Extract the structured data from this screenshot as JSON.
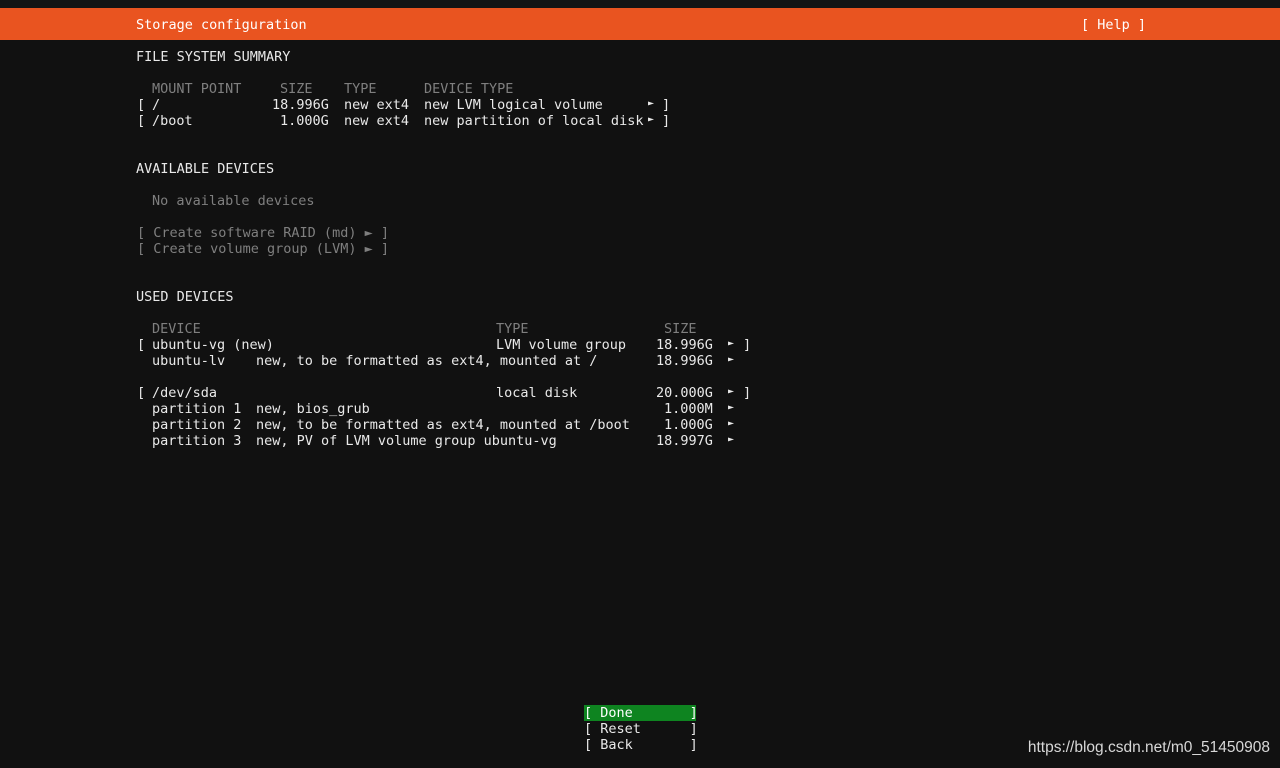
{
  "header": {
    "title": "Storage configuration",
    "help": "[ Help ]"
  },
  "fs_summary": {
    "heading": "FILE SYSTEM SUMMARY",
    "columns": [
      "MOUNT POINT",
      "SIZE",
      "TYPE",
      "DEVICE TYPE"
    ],
    "rows": [
      {
        "bracket_open": "[",
        "mount": "/",
        "size": "18.996G",
        "type": "new ext4",
        "device_type": "new LVM logical volume",
        "arrow": "►",
        "bracket_close": "]"
      },
      {
        "bracket_open": "[",
        "mount": "/boot",
        "size": "1.000G",
        "type": "new ext4",
        "device_type": "new partition of local disk",
        "arrow": "►",
        "bracket_close": "]"
      }
    ]
  },
  "available": {
    "heading": "AVAILABLE DEVICES",
    "none_text": "No available devices",
    "actions": [
      {
        "label": "[ Create software RAID (md) ► ]"
      },
      {
        "label": "[ Create volume group (LVM) ► ]"
      }
    ]
  },
  "used": {
    "heading": "USED DEVICES",
    "columns": [
      "DEVICE",
      "TYPE",
      "SIZE"
    ],
    "groups": [
      {
        "bracket_open": "[",
        "device": "ubuntu-vg (new)",
        "type": "LVM volume group",
        "size": "18.996G",
        "arrow": "►",
        "bracket_close": "]",
        "children": [
          {
            "name": "ubuntu-lv",
            "desc": "new, to be formatted as ext4, mounted at /",
            "size": "18.996G",
            "arrow": "►"
          }
        ]
      },
      {
        "bracket_open": "[",
        "device": "/dev/sda",
        "type": "local disk",
        "size": "20.000G",
        "arrow": "►",
        "bracket_close": "]",
        "children": [
          {
            "name": "partition 1",
            "desc": "new, bios_grub",
            "size": "1.000M",
            "arrow": "►"
          },
          {
            "name": "partition 2",
            "desc": "new, to be formatted as ext4, mounted at /boot",
            "size": "1.000G",
            "arrow": "►"
          },
          {
            "name": "partition 3",
            "desc": "new, PV of LVM volume group ubuntu-vg",
            "size": "18.997G",
            "arrow": "►"
          }
        ]
      }
    ]
  },
  "buttons": {
    "done": "[ Done       ]",
    "reset": "[ Reset      ]",
    "back": "[ Back       ]"
  },
  "watermark": "https://blog.csdn.net/m0_51450908",
  "colors": {
    "accent": "#e95420",
    "done_button": "#0e8420",
    "background": "#111111",
    "dim_text": "#7f7f7f"
  }
}
